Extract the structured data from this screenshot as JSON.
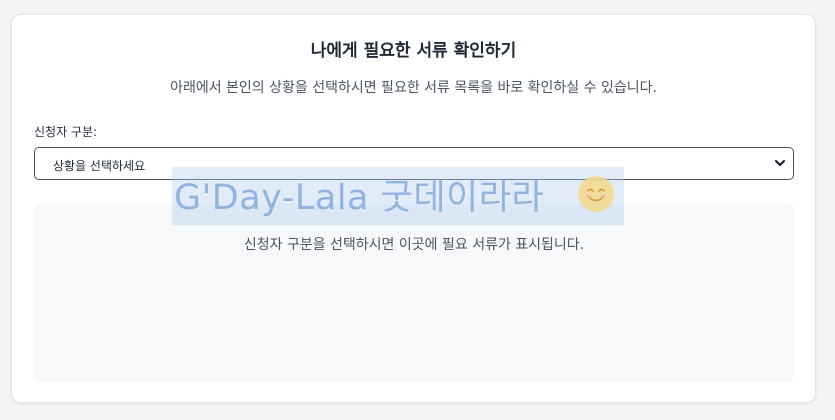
{
  "header": {
    "title": "나에게 필요한 서류 확인하기",
    "subtitle": "아래에서 본인의 상황을 선택하시면 필요한 서류 목록을 바로 확인하실 수 있습니다."
  },
  "form": {
    "label": "신청자 구분:",
    "select_value": "상황을 선택하세요",
    "chevron_icon": "chevron-down-icon"
  },
  "result": {
    "placeholder": "신청자 구분을 선택하시면 이곳에 필요 서류가 표시됩니다."
  },
  "watermark": {
    "text": "G'Day-Lala 굿데이라라",
    "emoji_icon": "smiley-face-icon"
  },
  "colors": {
    "card_background": "#ffffff",
    "result_background": "#f7f8fa",
    "text_primary": "#1f2937",
    "text_secondary": "#4b5563"
  }
}
